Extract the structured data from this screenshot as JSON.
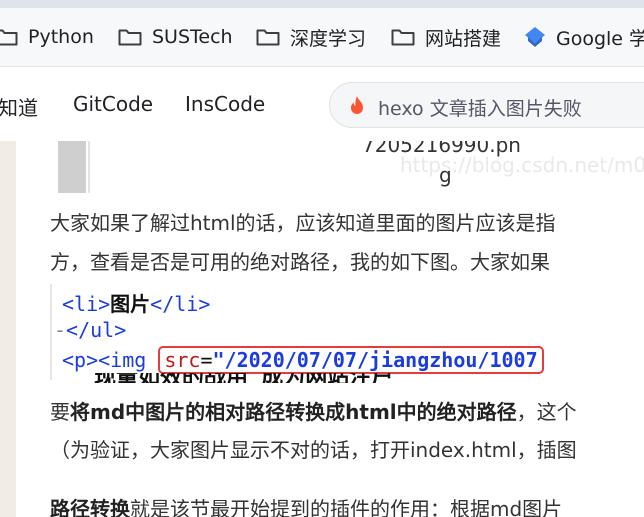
{
  "bookmarks": [
    {
      "label": "Python",
      "icon": "folder-icon"
    },
    {
      "label": "SUSTech",
      "icon": "folder-icon"
    },
    {
      "label": "深度学习",
      "icon": "folder-icon"
    },
    {
      "label": "网站搭建",
      "icon": "folder-icon"
    },
    {
      "label": "Google 学术",
      "icon": "google-scholar-icon"
    }
  ],
  "toolbar": {
    "nav": [
      "知道",
      "GitCode",
      "InsCode"
    ],
    "search_placeholder": "hexo 文章插入图片失败"
  },
  "article": {
    "image_caption_line1": "7205216990.pn",
    "image_caption_line2": "g",
    "watermark": "https://blog.csdn.net/m0",
    "para1_line1": "大家如果了解过html的话，应该知道里面的图片应该是指",
    "para1_line2": "方，查看是否是可用的绝对路径，我的如下图。大家如果",
    "code": {
      "line1_open": "<li>",
      "line1_text": "图片",
      "line1_close": "</li>",
      "line2": "</ul>",
      "line3_open": "<p><img ",
      "line3_attr": "src",
      "line3_eq": "=",
      "line3_value": "\"/2020/07/07/jiangzhou/1007",
      "cut_text": "现量如效的战用 成为网站注户"
    },
    "para2_pre": "要",
    "para2_bold": "将md中图片的相对路径转换成html中的绝对路径",
    "para2_post": "，这个",
    "para2_line2": "（为验证，大家图片显示不对的话，打开index.html，插图",
    "para3_bold": "路径转换",
    "para3_post": "就是该节最开始提到的插件的作用：根据md图片"
  },
  "colors": {
    "accent_red": "#e53d3d",
    "code_blue": "#1c3ddc",
    "page_bg": "#f1ede4"
  }
}
